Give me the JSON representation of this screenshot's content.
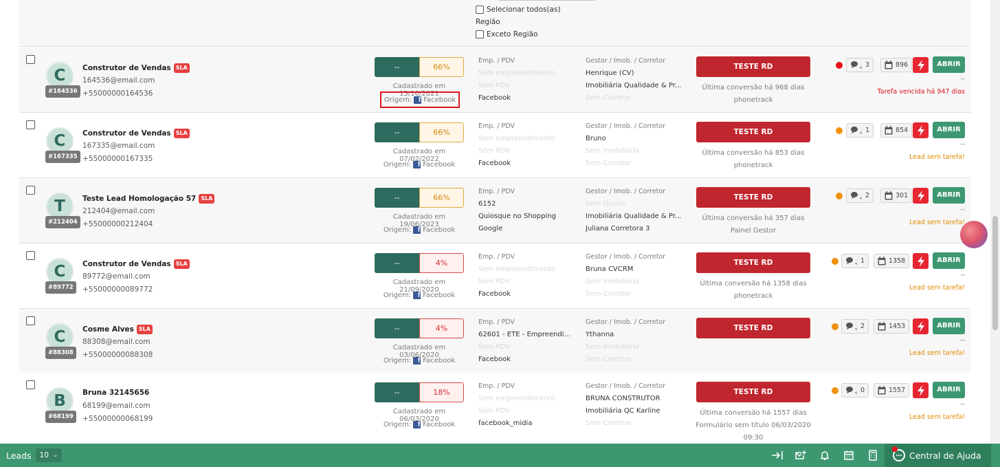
{
  "filters": {
    "select_all_label": "Selecionar todos(as)",
    "region_label": "Região",
    "except_region_label": "Exceto Região"
  },
  "columns": {
    "emp_header": "Emp. / PDV",
    "gestor_header": "Gestor / Imob. / Corretor"
  },
  "buttons": {
    "teste_rd": "TESTE RD",
    "abrir": "ABRIR"
  },
  "leads": [
    {
      "initial": "C",
      "id": "#164536",
      "name": "Construtor de Vendas",
      "sla": "SLA",
      "email": "164536@email.com",
      "phone": "+55000000164536",
      "progress_left": "--",
      "progress_pct": "66%",
      "progress_color": "amber",
      "cadastro": "Cadastrado em 15/10/2021",
      "origem_label": "Origem:",
      "origem_value": "Facebook",
      "emp_lines": [
        {
          "text": "Sem empreendimento",
          "muted": true
        },
        {
          "text": "Sem PDV",
          "muted": true
        },
        {
          "text": "Facebook",
          "muted": false
        }
      ],
      "gestor_lines": [
        {
          "text": "Henrique (CV)",
          "muted": false
        },
        {
          "text": "Imobiliária Qualidade & Pr...",
          "muted": false
        },
        {
          "text": "Sem Corretor",
          "muted": true
        }
      ],
      "conv_lines": [
        "Última conversão há 968 dias",
        "phonetrack"
      ],
      "dot_color": "red",
      "comments": "3",
      "tasks": "896",
      "status_dash": "--",
      "status_text": "Tarefa vencida há 947 dias",
      "status_color": "red"
    },
    {
      "initial": "C",
      "id": "#167335",
      "name": "Construtor de Vendas",
      "sla": "SLA",
      "email": "167335@email.com",
      "phone": "+55000000167335",
      "progress_left": "--",
      "progress_pct": "66%",
      "progress_color": "amber",
      "cadastro": "Cadastrado em 07/02/2022",
      "origem_label": "Origem:",
      "origem_value": "Facebook",
      "emp_lines": [
        {
          "text": "Sem empreendimento",
          "muted": true
        },
        {
          "text": "Sem PDV",
          "muted": true
        },
        {
          "text": "Facebook",
          "muted": false
        }
      ],
      "gestor_lines": [
        {
          "text": "Bruno",
          "muted": false
        },
        {
          "text": "Sem Imobiliária",
          "muted": true
        },
        {
          "text": "Sem Corretor",
          "muted": true
        }
      ],
      "conv_lines": [
        "Última conversão há 853 dias",
        "phonetrack"
      ],
      "dot_color": "orange",
      "comments": "1",
      "tasks": "854",
      "status_dash": "--",
      "status_text": "Lead sem tarefa!",
      "status_color": "orange"
    },
    {
      "initial": "T",
      "id": "#212404",
      "name": "Teste Lead Homologação 57",
      "sla": "SLA",
      "email": "212404@email.com",
      "phone": "+55000000212404",
      "progress_left": "--",
      "progress_pct": "66%",
      "progress_color": "amber",
      "cadastro": "Cadastrado em 19/06/2023",
      "origem_label": "Origem:",
      "origem_value": "Facebook",
      "emp_lines": [
        {
          "text": "6152",
          "muted": false
        },
        {
          "text": "Quiosque no Shopping",
          "muted": false
        },
        {
          "text": "Google",
          "muted": false
        }
      ],
      "gestor_lines": [
        {
          "text": "Sem Gestor",
          "muted": true
        },
        {
          "text": "Imobiliária Qualidade & Pr...",
          "muted": false
        },
        {
          "text": "Juliana Corretora 3",
          "muted": false
        }
      ],
      "conv_lines": [
        "Última conversão há 357 dias",
        "Painel Gestor"
      ],
      "dot_color": "orange",
      "comments": "2",
      "tasks": "301",
      "status_dash": "--",
      "status_text": "Lead sem tarefa!",
      "status_color": "orange"
    },
    {
      "initial": "C",
      "id": "#89772",
      "name": "Construtor de Vendas",
      "sla": "SLA",
      "email": "89772@email.com",
      "phone": "+55000000089772",
      "progress_left": "--",
      "progress_pct": "4%",
      "progress_color": "red",
      "cadastro": "Cadastrado em 21/09/2020",
      "origem_label": "Origem:",
      "origem_value": "Facebook",
      "emp_lines": [
        {
          "text": "Sem empreendimento",
          "muted": true
        },
        {
          "text": "Sem PDV",
          "muted": true
        },
        {
          "text": "Facebook",
          "muted": false
        }
      ],
      "gestor_lines": [
        {
          "text": "Bruna CVCRM",
          "muted": false
        },
        {
          "text": "Sem Imobiliária",
          "muted": true
        },
        {
          "text": "Sem Corretor",
          "muted": true
        }
      ],
      "conv_lines": [
        "Última conversão há 1358 dias",
        "phonetrack"
      ],
      "dot_color": "orange",
      "comments": "1",
      "tasks": "1358",
      "status_dash": "--",
      "status_text": "Lead sem tarefa!",
      "status_color": "orange"
    },
    {
      "initial": "C",
      "id": "#88308",
      "name": "Cosme Alves",
      "sla": "SLA",
      "email": "88308@email.com",
      "phone": "+55000000088308",
      "progress_left": "--",
      "progress_pct": "4%",
      "progress_color": "red",
      "cadastro": "Cadastrado em 03/06/2020",
      "origem_label": "Origem:",
      "origem_value": "Facebook",
      "emp_lines": [
        {
          "text": "62601 - ETE - Empreendi...",
          "muted": false
        },
        {
          "text": "Sem PDV",
          "muted": true
        },
        {
          "text": "Facebook",
          "muted": false
        }
      ],
      "gestor_lines": [
        {
          "text": "Ythanna",
          "muted": false
        },
        {
          "text": "Sem Imobiliária",
          "muted": true
        },
        {
          "text": "Sem Corretor",
          "muted": true
        }
      ],
      "conv_lines": [],
      "dot_color": "orange",
      "comments": "2",
      "tasks": "1453",
      "status_dash": "--",
      "status_text": "Lead sem tarefa!",
      "status_color": "orange"
    },
    {
      "initial": "B",
      "id": "#68199",
      "name": "Bruna 32145656",
      "sla": "",
      "email": "68199@email.com",
      "phone": "+55000000068199",
      "progress_left": "--",
      "progress_pct": "18%",
      "progress_color": "red",
      "cadastro": "Cadastrado em 06/03/2020",
      "origem_label": "Origem:",
      "origem_value": "Facebook",
      "emp_lines": [
        {
          "text": "Sem empreendimento",
          "muted": true
        },
        {
          "text": "Sem PDV",
          "muted": true
        },
        {
          "text": "facebook_midia",
          "muted": false
        }
      ],
      "gestor_lines": [
        {
          "text": "BRUNA CONSTRUTOR",
          "muted": false
        },
        {
          "text": "Imobiliária QC Karline",
          "muted": false
        },
        {
          "text": "Sem Corretor",
          "muted": true
        }
      ],
      "conv_lines": [
        "Última conversão há 1557 dias",
        "Formulário sem título 06/03/2020",
        "09:30"
      ],
      "dot_color": "orange",
      "comments": "0",
      "tasks": "1557",
      "status_dash": "--",
      "status_text": "Lead sem tarefa!",
      "status_color": "orange"
    }
  ],
  "bottom_bar": {
    "leads_label": "Leads",
    "page_size": "10",
    "help_label": "Central de Ajuda"
  },
  "icons": [
    "checkbox-icon",
    "facebook-icon",
    "comments-icon",
    "calendar-icon",
    "lightning-icon",
    "chevron-down-icon",
    "logout-icon",
    "add-message-icon",
    "bell-icon",
    "calendar-icon",
    "calculator-icon",
    "help-chat-icon"
  ],
  "colors": {
    "primary_green": "#3d9871",
    "dark_green": "#2e6b5f",
    "teste_red": "#c0262e",
    "sla_red": "#e74040",
    "overdue_red": "#d8121c",
    "no_task_orange": "#e08a00"
  }
}
